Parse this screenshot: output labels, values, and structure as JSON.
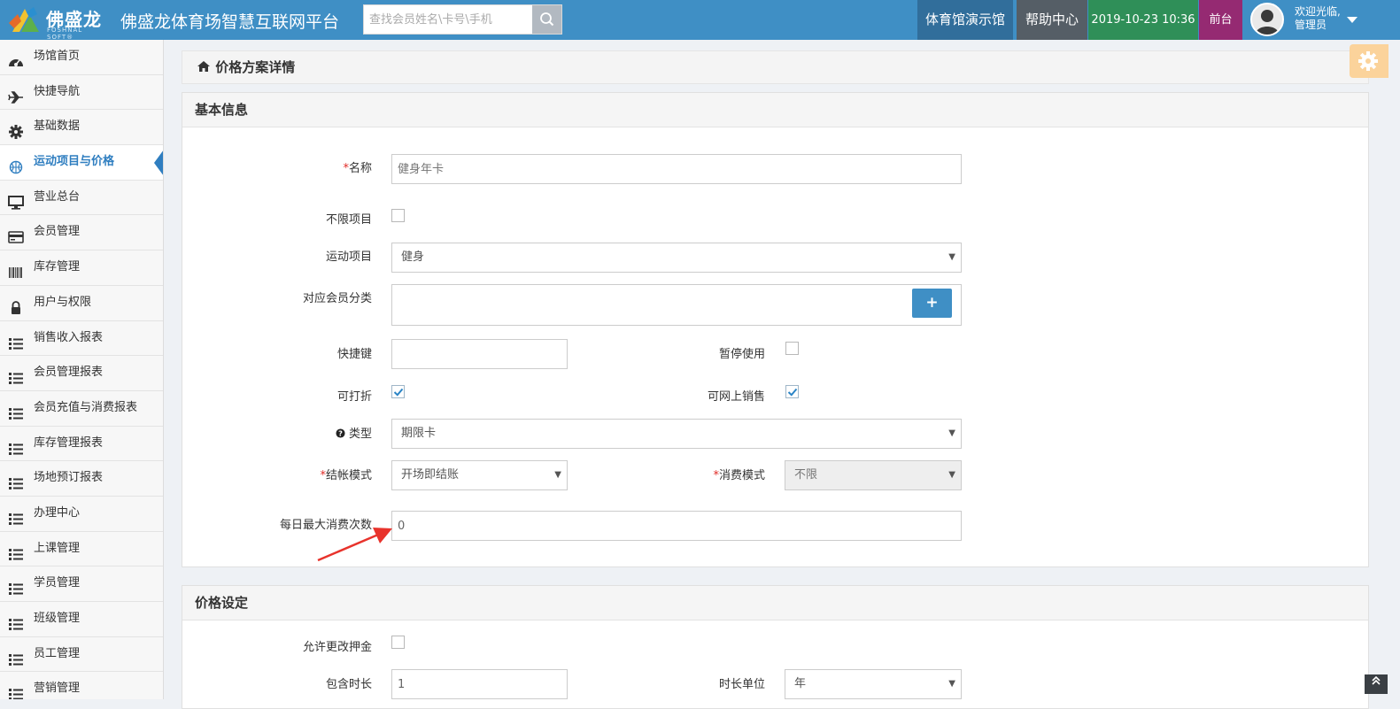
{
  "header": {
    "logo_brand": "佛盛龙",
    "logo_sub": "FOSHNAL SOFT®",
    "app_title": "佛盛龙体育场智慧互联网平台",
    "search_placeholder": "查找会员姓名\\卡号\\手机",
    "venue": "体育馆演示馆",
    "help": "帮助中心",
    "datetime": "2019-10-23 10:36",
    "front_desk": "前台",
    "welcome_line1": "欢迎光临,",
    "welcome_line2": "管理员"
  },
  "sidebar": {
    "items": [
      {
        "label": "场馆首页",
        "icon": "dashboard-icon"
      },
      {
        "label": "快捷导航",
        "icon": "plane-icon"
      },
      {
        "label": "基础数据",
        "icon": "gear-icon"
      },
      {
        "label": "运动项目与价格",
        "icon": "basketball-icon",
        "active": true
      },
      {
        "label": "营业总台",
        "icon": "monitor-icon"
      },
      {
        "label": "会员管理",
        "icon": "card-icon"
      },
      {
        "label": "库存管理",
        "icon": "barcode-icon"
      },
      {
        "label": "用户与权限",
        "icon": "lock-icon"
      },
      {
        "label": "销售收入报表",
        "icon": "list-icon"
      },
      {
        "label": "会员管理报表",
        "icon": "list-icon"
      },
      {
        "label": "会员充值与消费报表",
        "icon": "list-icon"
      },
      {
        "label": "库存管理报表",
        "icon": "list-icon"
      },
      {
        "label": "场地预订报表",
        "icon": "list-icon"
      },
      {
        "label": "办理中心",
        "icon": "list-icon"
      },
      {
        "label": "上课管理",
        "icon": "list-icon"
      },
      {
        "label": "学员管理",
        "icon": "list-icon"
      },
      {
        "label": "班级管理",
        "icon": "list-icon"
      },
      {
        "label": "员工管理",
        "icon": "list-icon"
      },
      {
        "label": "营销管理",
        "icon": "list-icon"
      }
    ]
  },
  "page": {
    "title": "价格方案详情"
  },
  "basic": {
    "heading": "基本信息",
    "name_label": "名称",
    "name_placeholder": "健身年卡",
    "unlimited_label": "不限项目",
    "unlimited_checked": false,
    "sport_label": "运动项目",
    "sport_value": "健身",
    "member_cat_label": "对应会员分类",
    "add_button": "+",
    "hotkey_label": "快捷键",
    "hotkey_value": "",
    "pause_label": "暂停使用",
    "pause_checked": false,
    "discount_label": "可打折",
    "discount_checked": true,
    "online_label": "可网上销售",
    "online_checked": true,
    "type_label": "类型",
    "type_value": "期限卡",
    "settle_label": "结帐模式",
    "settle_value": "开场即结账",
    "consume_label": "消费模式",
    "consume_value": "不限",
    "daily_max_label": "每日最大消费次数",
    "daily_max_value": "0"
  },
  "price": {
    "heading": "价格设定",
    "allow_deposit_label": "允许更改押金",
    "allow_deposit_checked": false,
    "duration_label": "包含时长",
    "duration_value": "1",
    "unit_label": "时长单位",
    "unit_value": "年"
  },
  "colors": {
    "header_blue": "#3f8fc5",
    "venue_bg": "#316e9b",
    "help_bg": "#555e66",
    "time_bg": "#2f8f58",
    "front_bg": "#952a72",
    "active_blue": "#2f7ec0",
    "required_red": "#e02b27",
    "annotation_arrow": "#e8332c"
  }
}
